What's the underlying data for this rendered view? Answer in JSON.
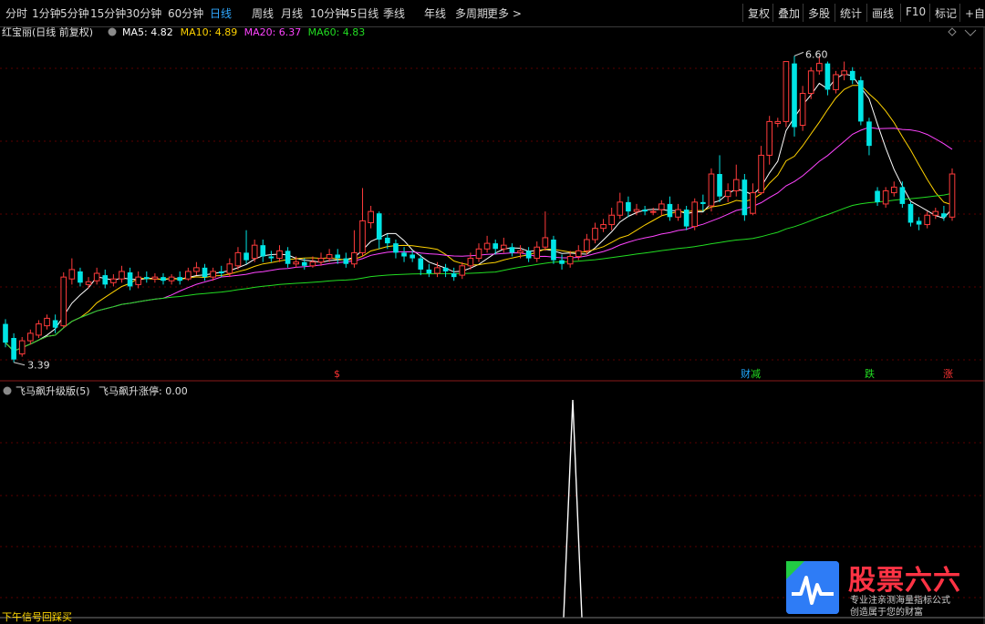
{
  "toolbar": {
    "tabs": [
      "分时",
      "1分钟",
      "5分钟",
      "15分钟",
      "30分钟",
      "60分钟",
      "日线",
      "周线",
      "月线",
      "10分钟",
      "45日线",
      "季线",
      "年线",
      "多周期",
      "更多 >"
    ],
    "active_tab": "日线",
    "right_buttons": [
      "复权",
      "叠加",
      "多股",
      "统计",
      "画线",
      "F10",
      "标记",
      "+自"
    ]
  },
  "main_panel": {
    "stock_name": "红宝丽(日线 前复权)",
    "ma_legend": [
      {
        "label": "MA5: 4.82",
        "color": "#ffffff"
      },
      {
        "label": "MA10: 4.89",
        "color": "#ffd200"
      },
      {
        "label": "MA20: 6.37",
        "color": "#ff44ff"
      },
      {
        "label": "MA60: 4.83",
        "color": "#22dd22"
      }
    ],
    "high_label": "6.60",
    "low_label": "3.39",
    "event_labels": [
      {
        "text": "$",
        "color": "#ff3333"
      },
      {
        "text": "财",
        "color": "#20a8ff"
      },
      {
        "text": "减",
        "color": "#22dd22"
      },
      {
        "text": "跌",
        "color": "#22dd22"
      },
      {
        "text": "涨",
        "color": "#ff3333"
      }
    ]
  },
  "chart_data": {
    "type": "candlestick",
    "y_range": [
      3.3,
      6.8
    ],
    "up_color": "#ff3b3b",
    "down_color": "#00e5e5",
    "candles": [
      [
        3.8,
        3.6,
        3.85,
        3.55
      ],
      [
        3.65,
        3.42,
        3.7,
        3.39
      ],
      [
        3.48,
        3.62,
        3.66,
        3.45
      ],
      [
        3.62,
        3.7,
        3.74,
        3.58
      ],
      [
        3.68,
        3.8,
        3.84,
        3.65
      ],
      [
        3.78,
        3.86,
        3.9,
        3.74
      ],
      [
        3.84,
        3.76,
        3.9,
        3.7
      ],
      [
        3.78,
        4.3,
        4.35,
        3.76
      ],
      [
        4.28,
        4.38,
        4.5,
        4.22
      ],
      [
        4.36,
        4.24,
        4.4,
        4.2
      ],
      [
        4.22,
        4.25,
        4.3,
        4.18
      ],
      [
        4.26,
        4.34,
        4.4,
        4.22
      ],
      [
        4.32,
        4.22,
        4.38,
        4.18
      ],
      [
        4.24,
        4.28,
        4.33,
        4.2
      ],
      [
        4.28,
        4.36,
        4.42,
        4.24
      ],
      [
        4.35,
        4.2,
        4.4,
        4.16
      ],
      [
        4.22,
        4.3,
        4.36,
        4.18
      ],
      [
        4.3,
        4.28,
        4.36,
        4.24
      ],
      [
        4.28,
        4.3,
        4.34,
        4.24
      ],
      [
        4.3,
        4.26,
        4.34,
        4.22
      ],
      [
        4.26,
        4.3,
        4.33,
        4.22
      ],
      [
        4.3,
        4.26,
        4.36,
        4.22
      ],
      [
        4.28,
        4.36,
        4.4,
        4.26
      ],
      [
        4.36,
        4.4,
        4.46,
        4.32
      ],
      [
        4.4,
        4.3,
        4.44,
        4.26
      ],
      [
        4.3,
        4.36,
        4.4,
        4.26
      ],
      [
        4.36,
        4.34,
        4.42,
        4.3
      ],
      [
        4.34,
        4.44,
        4.5,
        4.3
      ],
      [
        4.42,
        4.56,
        4.62,
        4.38
      ],
      [
        4.56,
        4.48,
        4.8,
        4.44
      ],
      [
        4.5,
        4.64,
        4.7,
        4.46
      ],
      [
        4.64,
        4.52,
        4.7,
        4.46
      ],
      [
        4.52,
        4.5,
        4.58,
        4.46
      ],
      [
        4.5,
        4.58,
        4.64,
        4.46
      ],
      [
        4.58,
        4.44,
        4.62,
        4.4
      ],
      [
        4.44,
        4.46,
        4.52,
        4.4
      ],
      [
        4.46,
        4.42,
        4.5,
        4.38
      ],
      [
        4.42,
        4.46,
        4.52,
        4.4
      ],
      [
        4.46,
        4.5,
        4.56,
        4.42
      ],
      [
        4.5,
        4.54,
        4.6,
        4.46
      ],
      [
        4.54,
        4.5,
        4.6,
        4.44
      ],
      [
        4.5,
        4.44,
        4.56,
        4.4
      ],
      [
        4.44,
        4.56,
        4.8,
        4.4
      ],
      [
        4.56,
        4.9,
        5.25,
        4.52
      ],
      [
        4.88,
        5.0,
        5.06,
        4.82
      ],
      [
        4.98,
        4.7,
        5.0,
        4.6
      ],
      [
        4.72,
        4.66,
        4.76,
        4.6
      ],
      [
        4.66,
        4.56,
        4.7,
        4.5
      ],
      [
        4.56,
        4.52,
        4.62,
        4.46
      ],
      [
        4.54,
        4.5,
        4.58,
        4.46
      ],
      [
        4.5,
        4.38,
        4.54,
        4.32
      ],
      [
        4.38,
        4.34,
        4.44,
        4.3
      ],
      [
        4.34,
        4.4,
        4.46,
        4.3
      ],
      [
        4.4,
        4.36,
        4.44,
        4.3
      ],
      [
        4.34,
        4.3,
        4.4,
        4.26
      ],
      [
        4.32,
        4.42,
        4.46,
        4.28
      ],
      [
        4.42,
        4.5,
        4.56,
        4.38
      ],
      [
        4.5,
        4.6,
        4.66,
        4.46
      ],
      [
        4.6,
        4.66,
        4.74,
        4.56
      ],
      [
        4.66,
        4.6,
        4.7,
        4.54
      ],
      [
        4.6,
        4.64,
        4.72,
        4.56
      ],
      [
        4.62,
        4.56,
        4.66,
        4.52
      ],
      [
        4.56,
        4.58,
        4.64,
        4.5
      ],
      [
        4.58,
        4.5,
        4.62,
        4.46
      ],
      [
        4.5,
        4.62,
        4.68,
        4.46
      ],
      [
        4.62,
        4.72,
        5.0,
        4.58
      ],
      [
        4.7,
        4.48,
        4.74,
        4.44
      ],
      [
        4.48,
        4.44,
        4.54,
        4.38
      ],
      [
        4.44,
        4.52,
        4.58,
        4.4
      ],
      [
        4.52,
        4.58,
        4.64,
        4.48
      ],
      [
        4.58,
        4.7,
        4.76,
        4.54
      ],
      [
        4.7,
        4.82,
        4.88,
        4.66
      ],
      [
        4.82,
        4.86,
        4.92,
        4.78
      ],
      [
        4.86,
        4.96,
        5.04,
        4.8
      ],
      [
        4.96,
        5.1,
        5.2,
        4.92
      ],
      [
        5.1,
        5.0,
        5.16,
        4.94
      ],
      [
        5.0,
        5.02,
        5.08,
        4.96
      ],
      [
        5.02,
        5.0,
        5.06,
        4.96
      ],
      [
        5.0,
        5.0,
        5.04,
        4.96
      ],
      [
        5.02,
        5.08,
        5.12,
        4.96
      ],
      [
        5.08,
        4.94,
        5.16,
        4.9
      ],
      [
        4.94,
        5.02,
        5.08,
        4.9
      ],
      [
        5.02,
        4.84,
        5.06,
        4.8
      ],
      [
        4.84,
        5.1,
        5.14,
        4.8
      ],
      [
        5.1,
        5.08,
        5.18,
        5.0
      ],
      [
        5.06,
        5.4,
        5.46,
        5.0
      ],
      [
        5.4,
        5.16,
        5.6,
        5.1
      ],
      [
        5.16,
        5.22,
        5.3,
        5.1
      ],
      [
        5.22,
        5.34,
        5.5,
        5.16
      ],
      [
        5.34,
        4.96,
        5.4,
        4.9
      ],
      [
        4.98,
        5.2,
        5.3,
        4.96
      ],
      [
        5.2,
        5.6,
        5.7,
        5.18
      ],
      [
        5.6,
        5.96,
        6.02,
        5.5
      ],
      [
        5.94,
        5.96,
        6.0,
        5.9
      ],
      [
        5.96,
        6.6,
        6.6,
        5.9
      ],
      [
        6.58,
        5.9,
        6.66,
        5.8
      ],
      [
        5.92,
        6.26,
        6.34,
        5.86
      ],
      [
        6.26,
        6.5,
        6.54,
        6.2
      ],
      [
        6.5,
        6.58,
        6.66,
        6.46
      ],
      [
        6.58,
        6.3,
        6.6,
        6.24
      ],
      [
        6.3,
        6.46,
        6.5,
        6.26
      ],
      [
        6.46,
        6.5,
        6.6,
        6.4
      ],
      [
        6.5,
        6.4,
        6.54,
        6.36
      ],
      [
        6.4,
        5.96,
        6.44,
        5.92
      ],
      [
        5.96,
        5.7,
        6.0,
        5.6
      ],
      [
        5.22,
        5.1,
        5.26,
        5.06
      ],
      [
        5.08,
        5.22,
        5.26,
        5.04
      ],
      [
        5.2,
        5.26,
        5.32,
        5.16
      ],
      [
        5.26,
        5.08,
        5.32,
        5.04
      ],
      [
        5.08,
        4.88,
        5.1,
        4.84
      ],
      [
        4.9,
        4.86,
        4.94,
        4.8
      ],
      [
        4.86,
        4.96,
        5.0,
        4.82
      ],
      [
        4.96,
        5.0,
        5.04,
        4.92
      ],
      [
        4.98,
        4.94,
        5.06,
        4.9
      ],
      [
        4.94,
        5.4,
        5.46,
        4.9
      ]
    ],
    "ma_series": [
      {
        "name": "MA5",
        "color": "#ffffff"
      },
      {
        "name": "MA10",
        "color": "#ffd200"
      },
      {
        "name": "MA20",
        "color": "#ff44ff"
      },
      {
        "name": "MA60",
        "color": "#22dd22"
      }
    ],
    "indicator": {
      "name": "飞马飙升级版(5)",
      "line_label": "飞马飙升涨停: 0.00",
      "values": [
        0,
        0,
        0,
        0,
        0,
        0,
        0,
        0,
        0,
        0,
        0,
        0,
        0,
        0,
        0,
        0,
        0,
        0,
        0,
        0,
        0,
        0,
        0,
        0,
        0,
        0,
        0,
        0,
        0,
        0,
        0,
        0,
        0,
        0,
        0,
        0,
        0,
        0,
        0,
        0,
        0,
        0,
        0,
        0,
        0,
        0,
        0,
        0,
        0,
        0,
        0,
        0,
        0,
        0,
        0,
        0,
        0,
        0,
        0,
        0,
        0,
        0,
        0,
        0,
        0,
        0,
        0,
        0,
        0,
        0,
        0,
        0,
        0,
        0,
        0,
        0,
        0,
        0,
        0,
        0,
        0,
        0,
        0,
        0,
        0,
        0,
        0,
        0,
        0,
        0,
        0,
        0,
        0,
        0,
        0,
        0,
        0,
        0,
        0,
        0,
        0,
        0,
        0,
        0,
        0,
        0,
        0,
        0,
        0,
        0,
        0,
        0,
        0,
        0,
        0,
        0,
        0,
        0,
        0,
        0
      ]
    }
  },
  "logo": {
    "title": "股票六六",
    "sub1": "专业注亲测海量指标公式",
    "sub2": "创造属于您的财富"
  },
  "status": "下午信号回踩买"
}
